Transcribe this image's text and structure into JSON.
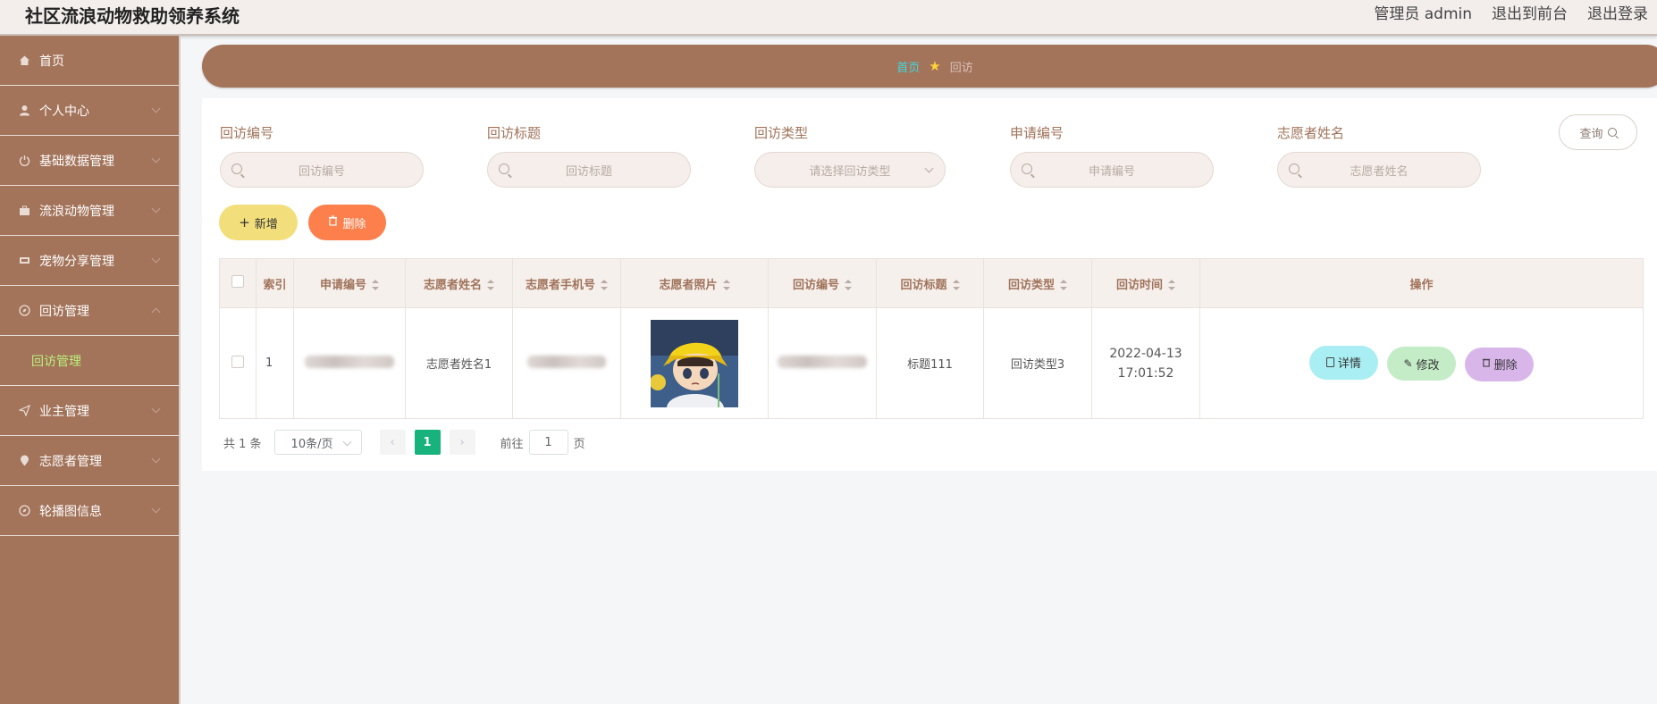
{
  "header": {
    "title": "社区流浪动物救助领养系统",
    "user_label": "管理员 admin",
    "to_front": "退出到前台",
    "logout": "退出登录"
  },
  "sidebar": {
    "items": [
      {
        "label": "首页",
        "icon": "home-icon"
      },
      {
        "label": "个人中心",
        "icon": "user-icon"
      },
      {
        "label": "基础数据管理",
        "icon": "power-icon"
      },
      {
        "label": "流浪动物管理",
        "icon": "briefcase-icon"
      },
      {
        "label": "宠物分享管理",
        "icon": "film-icon"
      },
      {
        "label": "回访管理",
        "icon": "compass-icon"
      },
      {
        "label": "业主管理",
        "icon": "send-icon"
      },
      {
        "label": "志愿者管理",
        "icon": "location-icon"
      },
      {
        "label": "轮播图信息",
        "icon": "compass-icon"
      }
    ],
    "submenu_active": "回访管理"
  },
  "breadcrumb": {
    "home": "首页",
    "current": "回访"
  },
  "filters": [
    {
      "label": "回访编号",
      "placeholder": "回访编号"
    },
    {
      "label": "回访标题",
      "placeholder": "回访标题"
    },
    {
      "label": "回访类型",
      "placeholder": "请选择回访类型"
    },
    {
      "label": "申请编号",
      "placeholder": "申请编号"
    },
    {
      "label": "志愿者姓名",
      "placeholder": "志愿者姓名"
    }
  ],
  "actions": {
    "query": "查询",
    "add": "新增",
    "delete": "删除"
  },
  "table": {
    "headers": [
      "索引",
      "申请编号",
      "志愿者姓名",
      "志愿者手机号",
      "志愿者照片",
      "回访编号",
      "回访标题",
      "回访类型",
      "回访时间",
      "操作"
    ],
    "row": {
      "index": "1",
      "volunteer_name": "志愿者姓名1",
      "title": "标题111",
      "type": "回访类型3",
      "time": "2022-04-13 17:01:52"
    },
    "row_actions": {
      "detail": "详情",
      "edit": "修改",
      "delete": "删除"
    }
  },
  "pagination": {
    "total": "共 1 条",
    "page_size": "10条/页",
    "current_page": "1",
    "goto_label": "前往",
    "goto_value": "1",
    "page_suffix": "页"
  }
}
